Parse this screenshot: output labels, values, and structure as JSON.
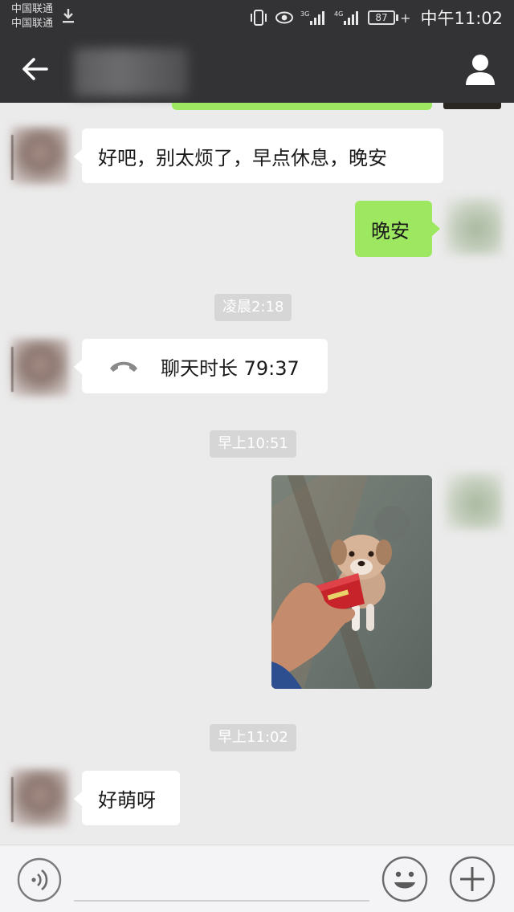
{
  "status_bar": {
    "carrier_1": "中国联通",
    "carrier_2": "中国联通",
    "network_3g": "3G",
    "network_4g": "4G",
    "battery_level": "87",
    "time": "中午11:02"
  },
  "title_bar": {
    "back_icon": "back-arrow-icon",
    "profile_icon": "person-icon"
  },
  "messages": [
    {
      "type": "text",
      "side": "left",
      "text": "好吧，别太烦了，早点休息，晚安"
    },
    {
      "type": "text",
      "side": "right",
      "text": "晚安"
    },
    {
      "type": "timestamp",
      "text": "凌晨2:18"
    },
    {
      "type": "call",
      "side": "left",
      "text": "聊天时长 79:37",
      "icon": "phone-handset-icon"
    },
    {
      "type": "timestamp",
      "text": "早上10:51"
    },
    {
      "type": "image",
      "side": "right",
      "alt": "puppy-photo"
    },
    {
      "type": "timestamp",
      "text": "早上11:02"
    },
    {
      "type": "text",
      "side": "left",
      "text": "好萌呀"
    }
  ],
  "input_bar": {
    "voice_icon": "voice-input-icon",
    "emoji_icon": "smiley-face-icon",
    "plus_icon": "plus-icon",
    "placeholder": ""
  },
  "colors": {
    "header_bg": "#333335",
    "chat_bg": "#ebebeb",
    "bubble_left": "#ffffff",
    "bubble_right": "#9ee861",
    "timestamp_bg": "#d6d6d6"
  }
}
